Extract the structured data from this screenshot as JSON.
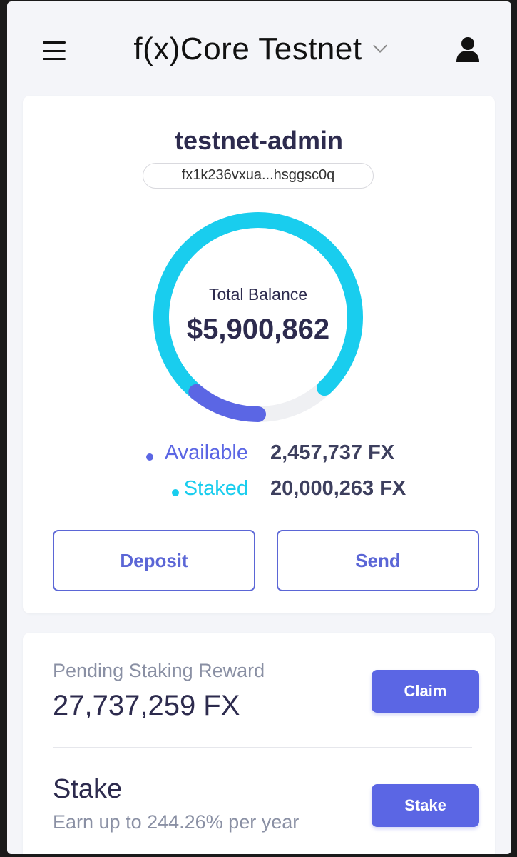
{
  "header": {
    "network": "f(x)Core Testnet"
  },
  "account": {
    "name": "testnet-admin",
    "address": "fx1k236vxua...hsggsc0q"
  },
  "balance": {
    "label": "Total Balance",
    "total": "$5,900,862",
    "available_label": "Available",
    "available_value": "2,457,737 FX",
    "staked_label": "Staked",
    "staked_value": "20,000,263 FX",
    "available_fraction": 0.11,
    "staked_fraction": 0.77
  },
  "actions": {
    "deposit": "Deposit",
    "send": "Send"
  },
  "reward": {
    "label": "Pending Staking Reward",
    "value": "27,737,259 FX",
    "claim": "Claim"
  },
  "stake": {
    "title": "Stake",
    "subtitle": "Earn up to 244.26% per year",
    "button": "Stake"
  },
  "colors": {
    "accent": "#5b66e4",
    "staked": "#19cdee",
    "available": "#5b66e4",
    "track": "#eff0f3"
  }
}
